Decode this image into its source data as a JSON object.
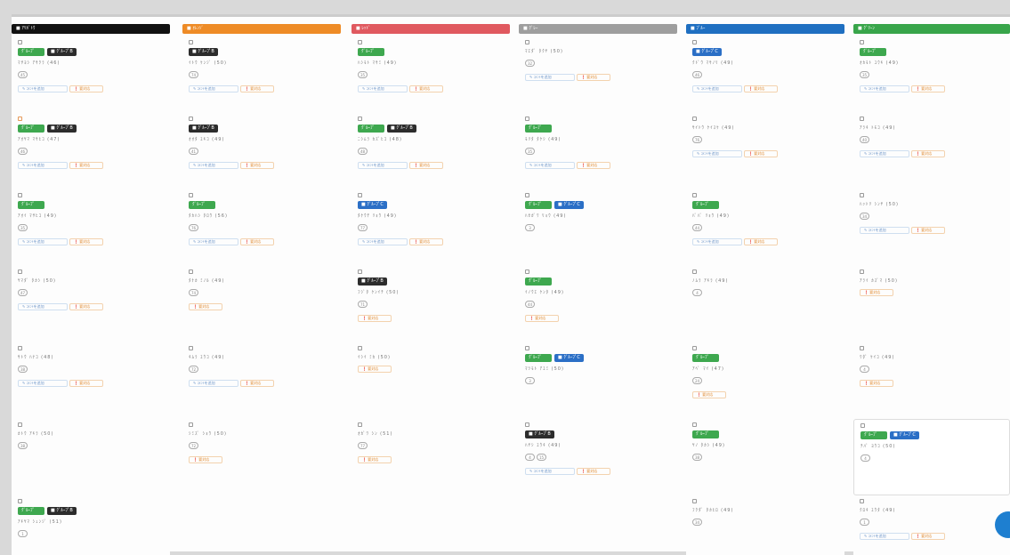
{
  "columns": [
    {
      "header": "■ ｱﾘｶﾞﾄｳ",
      "color": "#111111",
      "cards": [
        {
          "tags": [
            "green",
            "dark"
          ],
          "name": "ﾏｻﾖｼ ｱｻｸﾗ (46)",
          "counts": [
            "45"
          ],
          "pills": [
            "blue",
            "orange"
          ]
        },
        {
          "tags": [
            "green",
            "dark"
          ],
          "name": "ｱｵﾔﾏ ﾏｻﾋｺ (47)",
          "counts": [
            "46"
          ],
          "pills": [
            "blue",
            "orange"
          ],
          "check": "orange"
        },
        {
          "tags": [
            "green"
          ],
          "name": "ｱｵｲ ﾏｻﾋｺ (49)",
          "counts": [
            "35"
          ],
          "pills": [
            "blue",
            "orange"
          ]
        },
        {
          "tags": [],
          "name": "ﾔﾏﾀﾞ ﾀｶｼ (50)",
          "counts": [
            "47"
          ],
          "pills": [
            "blue",
            "orange"
          ]
        },
        {
          "tags": [],
          "name": "ｻﾄｳ ﾊﾅｺ (48)",
          "counts": [
            "38"
          ],
          "pills": [
            "blue",
            "orange"
          ]
        },
        {
          "tags": [],
          "name": "ｶﾄｳ ｱｷﾗ (50)",
          "counts": [
            "38"
          ],
          "pills": []
        },
        {
          "tags": [
            "green",
            "dark"
          ],
          "name": "ｱｷﾔﾏ ｼｭﾝｼﾞ (51)",
          "counts": [
            "1"
          ],
          "pills": []
        }
      ]
    },
    {
      "header": "■ ｵﾚﾝｼﾞ",
      "color": "#ee8b26",
      "cards": [
        {
          "tags": [
            "dark"
          ],
          "name": "ｲﾄｳ ｹﾝｼﾞ (50)",
          "counts": [
            "74"
          ],
          "pills": [
            "blue",
            "orange"
          ]
        },
        {
          "tags": [
            "dark"
          ],
          "name": "ｵｵﾀ ﾕｷｺ (49)",
          "counts": [
            "41"
          ],
          "pills": [
            "blue",
            "orange"
          ]
        },
        {
          "tags": [
            "green"
          ],
          "name": "ﾀｶﾊｼ ﾀﾛｳ (56)",
          "counts": [
            "76"
          ],
          "pills": [
            "blue",
            "orange"
          ]
        },
        {
          "tags": [],
          "name": "ﾀﾅｶ ﾐﾉﾙ (49)",
          "counts": [
            "74"
          ],
          "pills": [
            "orange"
          ]
        },
        {
          "tags": [],
          "name": "ｷﾑﾗ ﾕｳｺ (49)",
          "counts": [
            "72"
          ],
          "pills": [
            "blue",
            "orange"
          ]
        },
        {
          "tags": [],
          "name": "ｼﾐｽﾞ ｼｮｳ (50)",
          "counts": [
            "72"
          ],
          "pills": [
            "orange"
          ]
        }
      ]
    },
    {
      "header": "■ ﾚｯﾄﾞ",
      "color": "#e0595f",
      "cards": [
        {
          "tags": [
            "green"
          ],
          "name": "ﾊｼﾓﾄ ﾏｻﾐ (49)",
          "counts": [
            "35"
          ],
          "pills": [
            "blue",
            "orange"
          ]
        },
        {
          "tags": [
            "green",
            "dark"
          ],
          "name": "ﾆｼﾑﾗ ｶｽﾞﾋｺ (48)",
          "counts": [
            "48"
          ],
          "pills": [
            "blue",
            "orange"
          ]
        },
        {
          "tags": [
            "blue"
          ],
          "name": "ﾀｹｳﾁ ﾘｮｳ (49)",
          "counts": [
            "77"
          ],
          "pills": [
            "blue",
            "orange"
          ]
        },
        {
          "tags": [
            "dark"
          ],
          "name": "ﾌｼﾞﾀ ｹﾝｲﾁ (50)",
          "counts": [
            "71"
          ],
          "pills": [
            "orange"
          ]
        },
        {
          "tags": [],
          "name": "ｲｼｲ ﾐｶ (50)",
          "counts": [],
          "pills": [
            "orange"
          ]
        },
        {
          "tags": [],
          "name": "ｵｶﾞﾜ ｼﾝ (51)",
          "counts": [
            "77"
          ],
          "pills": [
            "orange"
          ]
        }
      ]
    },
    {
      "header": "■ ｸﾞﾚｰ",
      "color": "#9e9e9e",
      "cards": [
        {
          "tags": [],
          "name": "ﾏｴﾀﾞ ﾀｸﾔ (50)",
          "counts": [
            "32"
          ],
          "pills": [
            "blue",
            "orange"
          ]
        },
        {
          "tags": [
            "green"
          ],
          "name": "ﾓﾘﾀ ﾀｹｼ (49)",
          "counts": [
            "35"
          ],
          "pills": [
            "blue",
            "orange"
          ]
        },
        {
          "tags": [
            "green",
            "blue"
          ],
          "name": "ﾊｾｶﾞﾜ ﾘｮｳ (49)",
          "counts": [
            "3"
          ],
          "pills": []
        },
        {
          "tags": [
            "green"
          ],
          "name": "ｲﾉｳｴ ｹﾝﾀ (49)",
          "counts": [
            "44"
          ],
          "pills": [
            "orange"
          ]
        },
        {
          "tags": [
            "green",
            "blue"
          ],
          "name": "ﾏﾂﾓﾄ ｱﾕﾐ (50)",
          "counts": [
            "3"
          ],
          "pills": []
        },
        {
          "tags": [
            "dark"
          ],
          "name": "ﾊﾔｼ ﾕｳｷ (49)",
          "counts": [
            "4",
            "15"
          ],
          "pills": [
            "blue",
            "orange"
          ]
        }
      ]
    },
    {
      "header": "■ ﾌﾞﾙｰ",
      "color": "#1f6fc1",
      "cards": [
        {
          "tags": [
            "blue"
          ],
          "name": "ｸﾄﾞｳ ﾏｻﾉﾘ (49)",
          "counts": [
            "46"
          ],
          "pills": [
            "blue",
            "orange"
          ]
        },
        {
          "tags": [],
          "name": "ｻｲﾄｳ ｹｲｽｹ (49)",
          "counts": [
            "76"
          ],
          "pills": [
            "blue",
            "orange"
          ]
        },
        {
          "tags": [
            "green"
          ],
          "name": "ﾊﾞﾊﾞ ﾘｮｳ (49)",
          "counts": [
            "44"
          ],
          "pills": [
            "blue",
            "orange"
          ]
        },
        {
          "tags": [],
          "name": "ﾉﾑﾗ ｱｷﾗ (49)",
          "counts": [
            "4"
          ],
          "pills": []
        },
        {
          "tags": [
            "green"
          ],
          "name": "ｱﾍﾞ ﾏｲ (47)",
          "counts": [
            "24"
          ],
          "pills": [
            "orange"
          ]
        },
        {
          "tags": [
            "green"
          ],
          "name": "ﾔﾉ ﾀｶｼ (49)",
          "counts": [
            "38"
          ],
          "pills": []
        },
        {
          "tags": [],
          "name": "ﾌｸﾀﾞ ﾀｶﾋﾛ (49)",
          "counts": [
            "34"
          ],
          "pills": []
        }
      ]
    },
    {
      "header": "■ ｸﾞﾘｰﾝ",
      "color": "#38a54a",
      "cards": [
        {
          "tags": [
            "green"
          ],
          "name": "ｵｶﾓﾄ ﾕｳｷ (49)",
          "counts": [
            "35"
          ],
          "pills": [
            "blue",
            "orange"
          ]
        },
        {
          "tags": [],
          "name": "ｱﾗｷ ﾄﾓｺ (49)",
          "counts": [
            "40"
          ],
          "pills": [
            "blue",
            "orange"
          ]
        },
        {
          "tags": [],
          "name": "ﾊｯﾄﾘ ｼﾝﾔ (50)",
          "counts": [
            "34"
          ],
          "pills": [
            "blue",
            "orange"
          ]
        },
        {
          "tags": [],
          "name": "ｱﾗｲ ｶｽﾞﾏ (50)",
          "counts": [],
          "pills": [
            "orange"
          ]
        },
        {
          "tags": [],
          "name": "ﾜﾀﾞ ｹｲｺ (49)",
          "counts": [
            "4"
          ],
          "pills": [
            "orange"
          ]
        },
        {
          "tags": [
            "green",
            "blue"
          ],
          "name": "ﾁﾊﾞ ﾖｳｺ (50)",
          "counts": [
            "4"
          ],
          "pills": [],
          "boxed": true
        },
        {
          "tags": [],
          "name": "ｸﾛｷ ﾕｳﾀ (49)",
          "counts": [
            "1"
          ],
          "pills": [
            "blue",
            "orange"
          ]
        }
      ]
    }
  ],
  "labels": {
    "tag_green": "ｸﾞﾙｰﾌﾟ",
    "tag_dark": "■ ｸﾞﾙｰﾌﾟB",
    "tag_blue": "■ ｸﾞﾙｰﾌﾟC",
    "pill_blue": "✎ ｺﾒﾝﾄを追加",
    "pill_orange": "❗ 要対応"
  },
  "fab": {
    "icon": "plus-icon",
    "color": "#1e7fd0"
  }
}
